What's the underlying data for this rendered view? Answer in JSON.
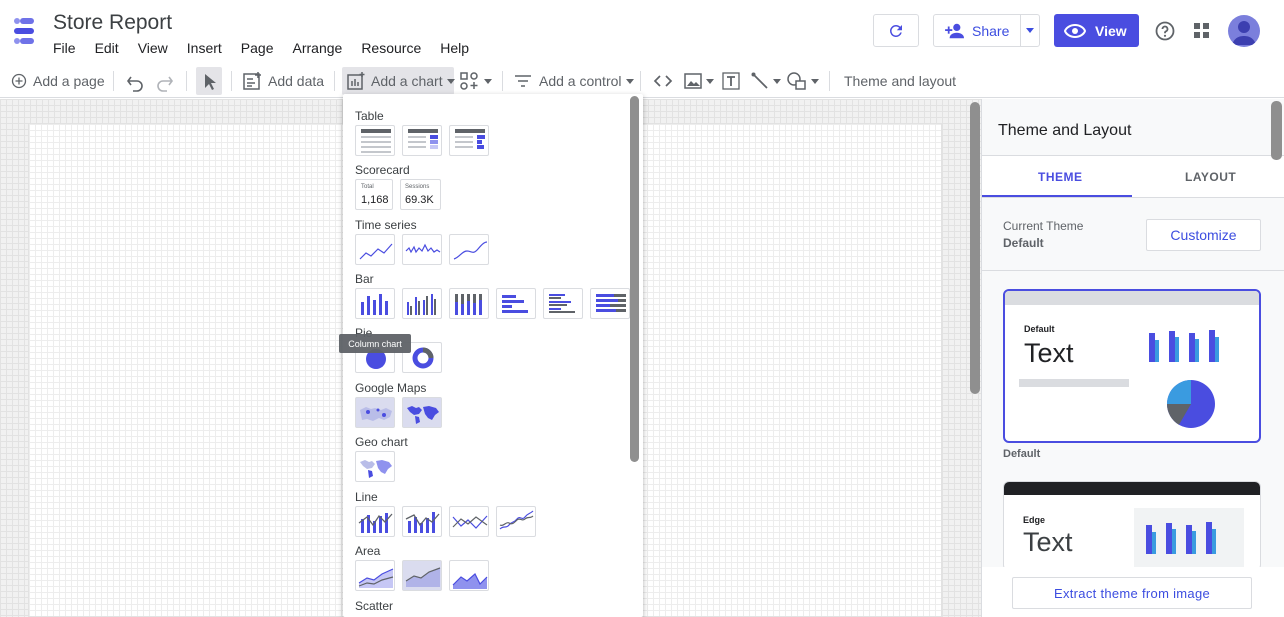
{
  "app": {
    "title": "Store Report",
    "menu": [
      "File",
      "Edit",
      "View",
      "Insert",
      "Page",
      "Arrange",
      "Resource",
      "Help"
    ],
    "share_label": "Share",
    "view_label": "View"
  },
  "toolbar": {
    "add_page": "Add a page",
    "add_data": "Add data",
    "add_chart": "Add a chart",
    "add_control": "Add a control",
    "theme_layout": "Theme and layout"
  },
  "chart_menu": {
    "sections": {
      "table": "Table",
      "scorecard": "Scorecard",
      "time_series": "Time series",
      "bar": "Bar",
      "pie": "Pie",
      "google_maps": "Google Maps",
      "geo_chart": "Geo chart",
      "line": "Line",
      "area": "Area",
      "scatter": "Scatter"
    },
    "scorecards": [
      {
        "label": "Total",
        "value": "1,168"
      },
      {
        "label": "Sessions",
        "value": "69.3K"
      }
    ],
    "tooltip": "Column chart"
  },
  "panel": {
    "title": "Theme and Layout",
    "tabs": [
      "THEME",
      "LAYOUT"
    ],
    "current_theme_label": "Current Theme",
    "current_theme_value": "Default",
    "customize": "Customize",
    "themes": [
      {
        "small": "Default",
        "big": "Text",
        "caption": "Default"
      },
      {
        "small": "Edge",
        "big": "Text"
      }
    ],
    "extract": "Extract theme from image"
  },
  "colors": {
    "accent": "#4a4de0",
    "series_blue": "#4a4de0",
    "series_light": "#3a9be0"
  }
}
